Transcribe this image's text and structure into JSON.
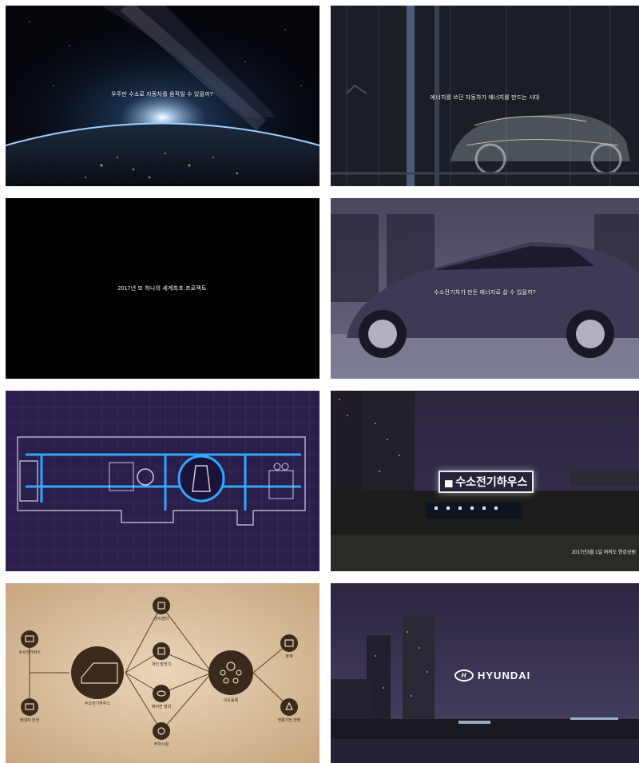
{
  "panels": [
    {
      "id": "earth-space",
      "caption": "우주만 수소로 자동차를 움직일 수 있을까?"
    },
    {
      "id": "car-xray",
      "caption": "에너지를 쓰던 자동차가 에너지를 만드는 시대"
    },
    {
      "id": "black-title",
      "caption": "2017년 또 하나의 세계최초 프로젝트"
    },
    {
      "id": "car-indoor",
      "caption": "수소전기차가 만든 에너지로 살 수 있을까?"
    },
    {
      "id": "floorplan",
      "caption": ""
    },
    {
      "id": "night-house",
      "sign_text": "수소전기하우스",
      "date_text": "2017년3월 1일 여의도 한강공원"
    },
    {
      "id": "energy-diagram",
      "center_left_label": "수소전기하우스",
      "center_right_label": "이웃등록",
      "left_labels": [
        "수소전기버스",
        "현대차 안전"
      ],
      "middle_labels": [
        "관리센터",
        "개인 발전기",
        "에어컨 정리",
        "주차시설"
      ],
      "right_labels": [
        "화재",
        "생활가전 전력"
      ]
    },
    {
      "id": "hyundai-logo",
      "brand_text": "HYUNDAI"
    }
  ],
  "colors": {
    "space_dark": "#05070d",
    "earth_glow": "#7ab6ff",
    "plan_bg": "#2b1e4a",
    "plan_line": "#2fa8ff",
    "diagram_bg": "#e0c8a8",
    "diagram_dark": "#3a2a1c",
    "night_sky": "#2c2540"
  }
}
